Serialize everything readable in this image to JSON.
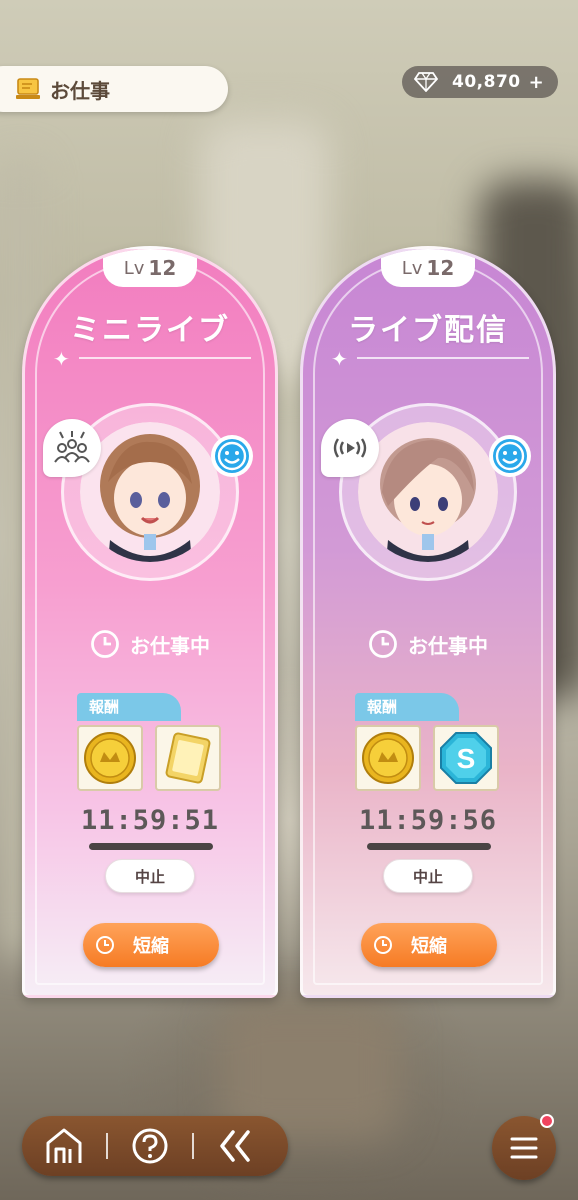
{
  "header": {
    "title": "お仕事"
  },
  "currency": {
    "amount": "40,870",
    "plus": "+"
  },
  "cards": [
    {
      "level_prefix": "Lv",
      "level": "12",
      "title": "ミニライブ",
      "status": "お仕事中",
      "reward_label": "報酬",
      "timer": "11:59:51",
      "stop_label": "中止",
      "shorten_label": "短縮",
      "theme": "#f27dbf"
    },
    {
      "level_prefix": "Lv",
      "level": "12",
      "title": "ライブ配信",
      "status": "お仕事中",
      "reward_label": "報酬",
      "timer": "11:59:56",
      "stop_label": "中止",
      "shorten_label": "短縮",
      "theme": "#c786d4"
    }
  ],
  "colors": {
    "accent_orange": "#f67b24",
    "reward_blue": "#7bc8e8",
    "mood_blue": "#2aa8ea",
    "nav_brown": "#7a4a2a",
    "notification_red": "#f0435e"
  },
  "icons": {
    "header": "job-board-icon",
    "currency": "diamond-icon",
    "card1_type": "audience-icon",
    "card2_type": "broadcast-icon",
    "mood": "smile-icon",
    "nav": [
      "home-icon",
      "help-icon",
      "back-icon",
      "menu-icon"
    ]
  }
}
